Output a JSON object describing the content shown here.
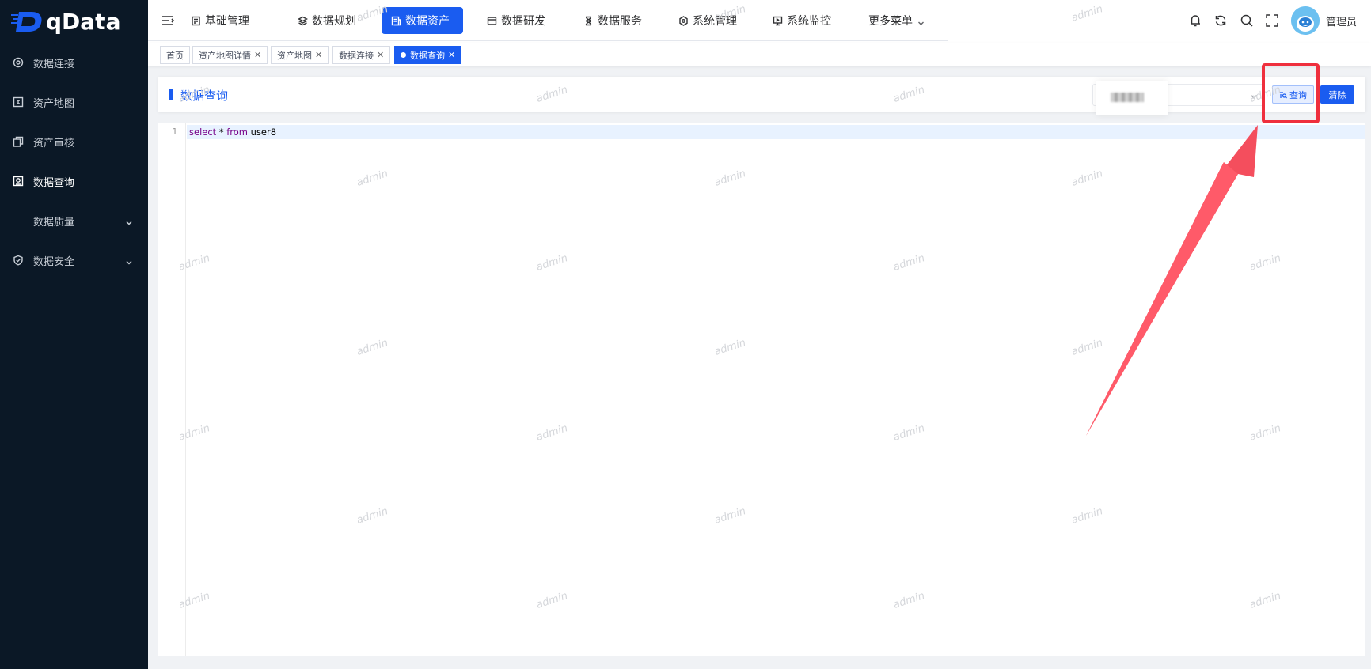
{
  "app": {
    "logo_text": "qData"
  },
  "sidebar": {
    "items": [
      {
        "label": "数据连接",
        "icon": "target-icon",
        "active": false
      },
      {
        "label": "资产地图",
        "icon": "map-icon",
        "active": false
      },
      {
        "label": "资产审核",
        "icon": "copy-icon",
        "active": false
      },
      {
        "label": "数据查询",
        "icon": "query-icon",
        "active": true
      },
      {
        "label": "数据质量",
        "icon": "none",
        "active": false,
        "expandable": true
      },
      {
        "label": "数据安全",
        "icon": "shield-icon",
        "active": false,
        "expandable": true
      }
    ]
  },
  "topnav": {
    "items": [
      {
        "label": "基础管理",
        "icon": "doc-icon"
      },
      {
        "label": "数据规划",
        "icon": "layers-icon"
      },
      {
        "label": "数据资产",
        "icon": "asset-icon",
        "active": true
      },
      {
        "label": "数据研发",
        "icon": "window-icon"
      },
      {
        "label": "数据服务",
        "icon": "hourglass-icon"
      },
      {
        "label": "系统管理",
        "icon": "gear-icon"
      },
      {
        "label": "系统监控",
        "icon": "monitor-icon"
      },
      {
        "label": "更多菜单",
        "icon": "none",
        "dropdown": true
      }
    ],
    "user": "管理员"
  },
  "tabs": [
    {
      "label": "首页",
      "closable": false
    },
    {
      "label": "资产地图详情",
      "closable": true
    },
    {
      "label": "资产地图",
      "closable": true
    },
    {
      "label": "数据连接",
      "closable": true
    },
    {
      "label": "数据查询",
      "closable": true,
      "active": true
    }
  ],
  "panel": {
    "title": "数据查询",
    "query_label": "查询",
    "clear_label": "清除"
  },
  "editor": {
    "line_number": "1",
    "code": {
      "kw1": "select",
      "op": " * ",
      "kw2": "from",
      "table": " user8"
    }
  },
  "watermark": "admin",
  "colors": {
    "primary": "#1a5cf0",
    "sidebar": "#0b1826",
    "annotation": "#ef2f3d"
  }
}
